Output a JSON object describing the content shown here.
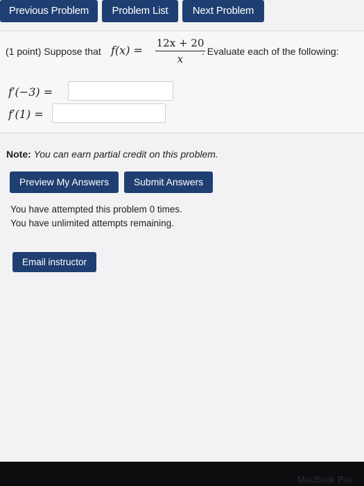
{
  "nav": {
    "previous_label": "Previous Problem",
    "list_label": "Problem List",
    "next_label": "Next Problem"
  },
  "problem": {
    "points": "(1 point) Suppose that",
    "function_lhs": "f(x) =",
    "numerator": "12x + 20",
    "denominator": "x",
    "instruction": ". Evaluate each of the following:",
    "questions": [
      {
        "label": "f′(−3) =",
        "value": ""
      },
      {
        "label": "f′(1) =",
        "value": ""
      }
    ]
  },
  "note": {
    "bold": "Note:",
    "text": "You can earn partial credit on this problem."
  },
  "actions": {
    "preview_label": "Preview My Answers",
    "submit_label": "Submit Answers"
  },
  "attempts": {
    "line1": "You have attempted this problem 0 times.",
    "line2": "You have unlimited attempts remaining."
  },
  "email": {
    "label": "Email instructor"
  },
  "device": {
    "label": "MacBook Pro"
  },
  "colors": {
    "button_bg": "#1f3f72",
    "button_text": "#ffffff"
  }
}
